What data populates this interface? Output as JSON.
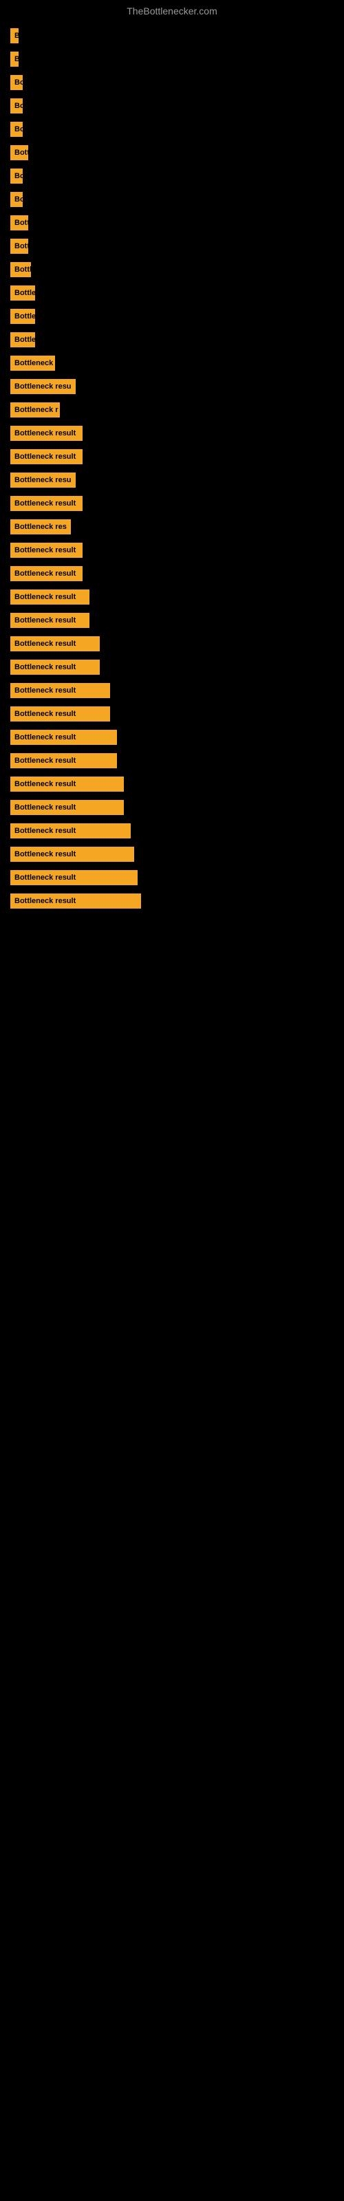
{
  "site": {
    "title": "TheBottlenecker.com"
  },
  "bars": [
    {
      "id": 1,
      "label": "B",
      "width": 12
    },
    {
      "id": 2,
      "label": "B",
      "width": 12
    },
    {
      "id": 3,
      "label": "Bo",
      "width": 18
    },
    {
      "id": 4,
      "label": "Bo",
      "width": 18
    },
    {
      "id": 5,
      "label": "Bo",
      "width": 18
    },
    {
      "id": 6,
      "label": "Bott",
      "width": 26
    },
    {
      "id": 7,
      "label": "Bo",
      "width": 18
    },
    {
      "id": 8,
      "label": "Bo",
      "width": 18
    },
    {
      "id": 9,
      "label": "Bott",
      "width": 26
    },
    {
      "id": 10,
      "label": "Bott",
      "width": 26
    },
    {
      "id": 11,
      "label": "Bottl",
      "width": 30
    },
    {
      "id": 12,
      "label": "Bottle",
      "width": 36
    },
    {
      "id": 13,
      "label": "Bottle",
      "width": 36
    },
    {
      "id": 14,
      "label": "Bottle",
      "width": 36
    },
    {
      "id": 15,
      "label": "Bottleneck",
      "width": 65
    },
    {
      "id": 16,
      "label": "Bottleneck resu",
      "width": 95
    },
    {
      "id": 17,
      "label": "Bottleneck r",
      "width": 72
    },
    {
      "id": 18,
      "label": "Bottleneck result",
      "width": 105
    },
    {
      "id": 19,
      "label": "Bottleneck result",
      "width": 105
    },
    {
      "id": 20,
      "label": "Bottleneck resu",
      "width": 95
    },
    {
      "id": 21,
      "label": "Bottleneck result",
      "width": 105
    },
    {
      "id": 22,
      "label": "Bottleneck res",
      "width": 88
    },
    {
      "id": 23,
      "label": "Bottleneck result",
      "width": 105
    },
    {
      "id": 24,
      "label": "Bottleneck result",
      "width": 105
    },
    {
      "id": 25,
      "label": "Bottleneck result",
      "width": 115
    },
    {
      "id": 26,
      "label": "Bottleneck result",
      "width": 115
    },
    {
      "id": 27,
      "label": "Bottleneck result",
      "width": 130
    },
    {
      "id": 28,
      "label": "Bottleneck result",
      "width": 130
    },
    {
      "id": 29,
      "label": "Bottleneck result",
      "width": 145
    },
    {
      "id": 30,
      "label": "Bottleneck result",
      "width": 145
    },
    {
      "id": 31,
      "label": "Bottleneck result",
      "width": 155
    },
    {
      "id": 32,
      "label": "Bottleneck result",
      "width": 155
    },
    {
      "id": 33,
      "label": "Bottleneck result",
      "width": 165
    },
    {
      "id": 34,
      "label": "Bottleneck result",
      "width": 165
    },
    {
      "id": 35,
      "label": "Bottleneck result",
      "width": 175
    },
    {
      "id": 36,
      "label": "Bottleneck result",
      "width": 180
    },
    {
      "id": 37,
      "label": "Bottleneck result",
      "width": 185
    },
    {
      "id": 38,
      "label": "Bottleneck result",
      "width": 190
    }
  ]
}
